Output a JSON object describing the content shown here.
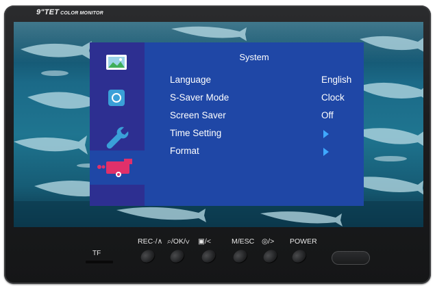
{
  "device": {
    "brand": "9\"TET",
    "brand_sub": "COLOR MONITOR"
  },
  "menu": {
    "title": "System",
    "categories": [
      {
        "icon": "picture-icon",
        "active": false
      },
      {
        "icon": "color-circle-icon",
        "active": false
      },
      {
        "icon": "wrench-icon",
        "active": false
      },
      {
        "icon": "camera-record-icon",
        "active": true
      }
    ],
    "items": [
      {
        "label": "Language",
        "value": "English"
      },
      {
        "label": "S-Saver Mode",
        "value": "Clock"
      },
      {
        "label": "Screen Saver",
        "value": "Off"
      },
      {
        "label": "Time Setting",
        "value": ""
      },
      {
        "label": "Format",
        "value": ""
      }
    ],
    "colors": {
      "sidebar": "#2d2f91",
      "panel": "#1f47a6",
      "arrow": "#3fa8ff"
    }
  },
  "hardware": {
    "tf_label": "TF",
    "buttons": [
      {
        "label": "REC·/∧"
      },
      {
        "label": "⌕/OK/∨"
      },
      {
        "label": "▣/<"
      },
      {
        "label": "M/ESC"
      },
      {
        "label": "◎/>"
      },
      {
        "label": "POWER"
      }
    ]
  }
}
